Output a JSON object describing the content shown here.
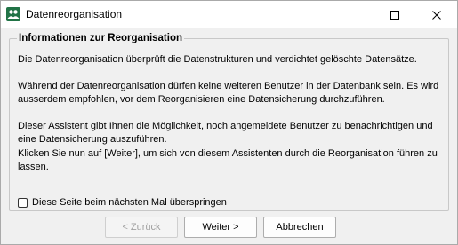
{
  "window": {
    "title": "Datenreorganisation"
  },
  "group": {
    "title": "Informationen zur Reorganisation",
    "paragraphs": [
      "Die Datenreorganisation überprüft die Datenstrukturen und verdichtet gelöschte Datensätze.",
      "Während der Datenreorganisation dürfen keine weiteren Benutzer in der Datenbank sein. Es wird ausserdem empfohlen, vor dem Reorganisieren eine Datensicherung durchzuführen.",
      "Dieser Assistent gibt Ihnen die Möglichkeit, noch angemeldete Benutzer zu benachrichtigen und eine Datensicherung auszuführen.",
      "Klicken Sie nun auf [Weiter], um sich von diesem Assistenten durch die Reorganisation führen zu lassen."
    ],
    "skip_checkbox": {
      "label": "Diese Seite beim nächsten Mal überspringen",
      "checked": false
    }
  },
  "buttons": {
    "back": "< Zurück",
    "next": "Weiter >",
    "cancel": "Abbrechen"
  },
  "icons": {
    "app": "users-app-icon",
    "maximize": "maximize-icon",
    "close": "close-icon"
  },
  "colors": {
    "app_icon": "#217346"
  }
}
